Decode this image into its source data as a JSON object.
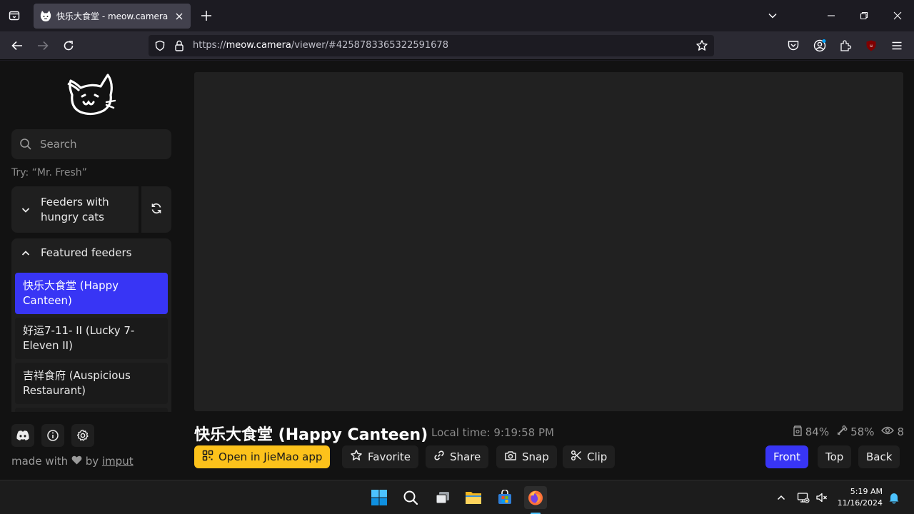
{
  "browser": {
    "tab_title": "快乐大食堂 - meow.camera",
    "url_prefix": "https://",
    "url_host": "meow.camera",
    "url_path": "/viewer/#4258783365322591678"
  },
  "sidebar": {
    "search_placeholder": "Search",
    "hint": "Try: “Mr. Fresh”",
    "category_hungry": [
      "Feeders with",
      "hungry cats"
    ],
    "category_featured": "Featured feeders",
    "feeders": [
      [
        "快乐大食堂 (Happy",
        "Canteen)"
      ],
      [
        "好运7-11- II (Lucky 7-",
        "Eleven II)"
      ],
      [
        "吉祥食府 (Auspicious",
        "Restaurant)"
      ]
    ],
    "made_with": "made with",
    "by": "by",
    "author": "imput"
  },
  "viewer": {
    "title": "快乐大食堂 (Happy Canteen)",
    "local_time": "Local time: 9:19:58 PM",
    "stats": {
      "food": "84%",
      "treats": "58%",
      "viewers": "8"
    },
    "actions": {
      "open_app": "Open in JieMao app",
      "favorite": "Favorite",
      "share": "Share",
      "snap": "Snap",
      "clip": "Clip"
    },
    "cameras": {
      "front": "Front",
      "top": "Top",
      "back": "Back"
    }
  },
  "taskbar": {
    "time": "5:19 AM",
    "date": "11/16/2024"
  },
  "colors": {
    "accent_blue": "#3835f5",
    "accent_yellow": "#fcc21b"
  }
}
